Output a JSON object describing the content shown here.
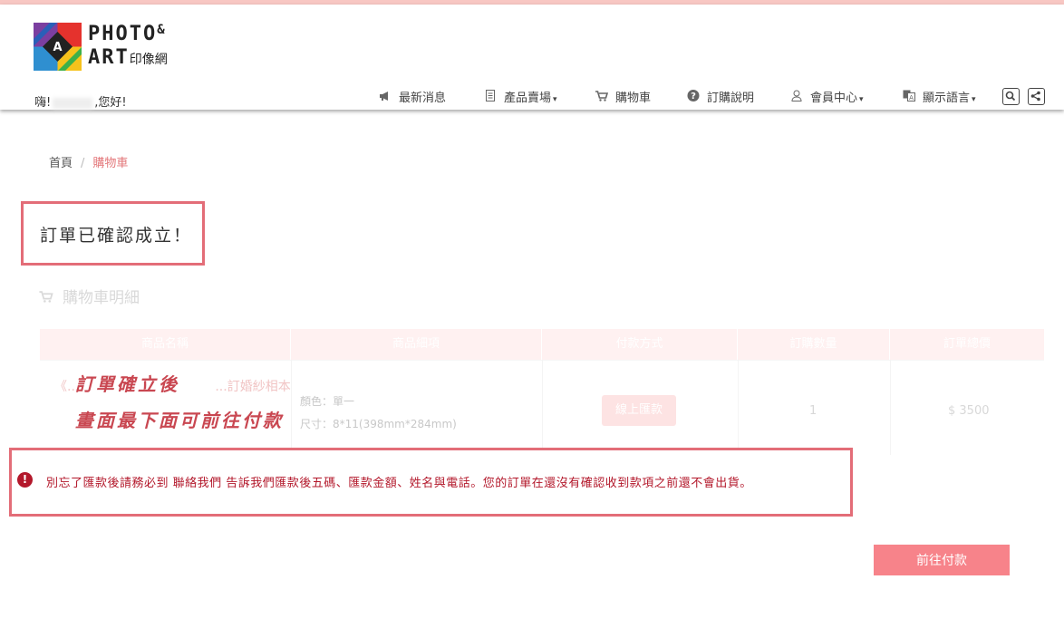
{
  "header": {
    "logo_line1": "PHOTO",
    "logo_amp": "&",
    "logo_line2": "ART",
    "logo_cn": "印像網",
    "greeting_prefix": "嗨!",
    "greeting_suffix": ",您好!"
  },
  "nav": {
    "items": [
      {
        "label": "最新消息",
        "icon": "megaphone-icon"
      },
      {
        "label": "產品賣場",
        "icon": "document-icon",
        "dropdown": true
      },
      {
        "label": "購物車",
        "icon": "cart-icon"
      },
      {
        "label": "訂購說明",
        "icon": "question-icon"
      },
      {
        "label": "會員中心",
        "icon": "user-icon",
        "dropdown": true
      },
      {
        "label": "顯示語言",
        "icon": "translate-icon",
        "dropdown": true
      }
    ],
    "caret": "▾"
  },
  "breadcrumb": {
    "home": "首頁",
    "separator": "/",
    "current": "購物車"
  },
  "confirm_message": "訂單已確認成立！",
  "cart": {
    "title": "購物車明細",
    "columns": [
      "商品名稱",
      "商品細項",
      "付款方式",
      "訂購數量",
      "訂單總價"
    ],
    "row": {
      "product": "《...",
      "product_tail": "...訂婚紗相本",
      "spec_color": "顏色：單一",
      "spec_size": "尺寸：8*11(398mm*284mm)",
      "payment": "線上匯款",
      "qty": "1",
      "price": "$ 3500"
    }
  },
  "annotation": {
    "line1": "訂單確立後",
    "line2": "畫面最下面可前往付款"
  },
  "alert": {
    "icon": "!",
    "text": "別忘了匯款後請務必到 聯絡我們 告訴我們匯款後五碼、匯款金額、姓名與電話。您的訂單在還沒有確認收到款項之前還不會出貨。"
  },
  "go_pay_label": "前往付款",
  "colors": {
    "accent": "#f7838a",
    "highlight_border": "#e36d78",
    "alert_red": "#b3182b"
  }
}
